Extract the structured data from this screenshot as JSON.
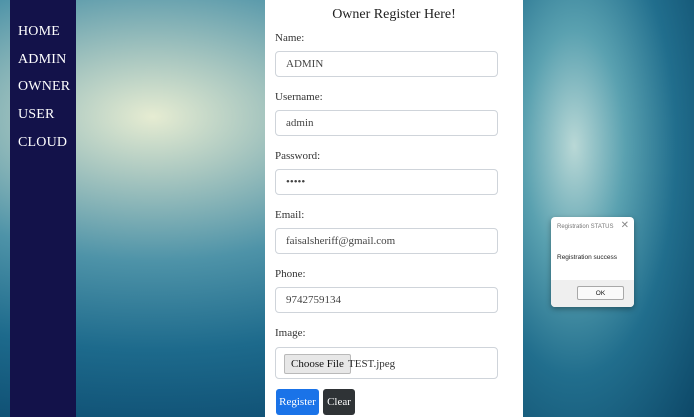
{
  "nav": {
    "items": [
      {
        "label": "HOME"
      },
      {
        "label": "ADMIN"
      },
      {
        "label": "OWNER"
      },
      {
        "label": "USER"
      },
      {
        "label": "CLOUD"
      }
    ]
  },
  "form": {
    "title": "Owner Register Here!",
    "name": {
      "label": "Name:",
      "value": "ADMIN"
    },
    "username": {
      "label": "Username:",
      "value": "admin"
    },
    "password": {
      "label": "Password:",
      "value": "•••••"
    },
    "email": {
      "label": "Email:",
      "value": "faisalsheriff@gmail.com"
    },
    "phone": {
      "label": "Phone:",
      "value": "9742759134"
    },
    "image": {
      "label": "Image:",
      "button": "Choose File",
      "filename": "TEST.jpeg"
    },
    "register_label": "Register",
    "clear_label": "Clear"
  },
  "dialog": {
    "title": "Registration STATUS",
    "close": "✕",
    "message": "Registration success",
    "ok_label": "OK"
  }
}
